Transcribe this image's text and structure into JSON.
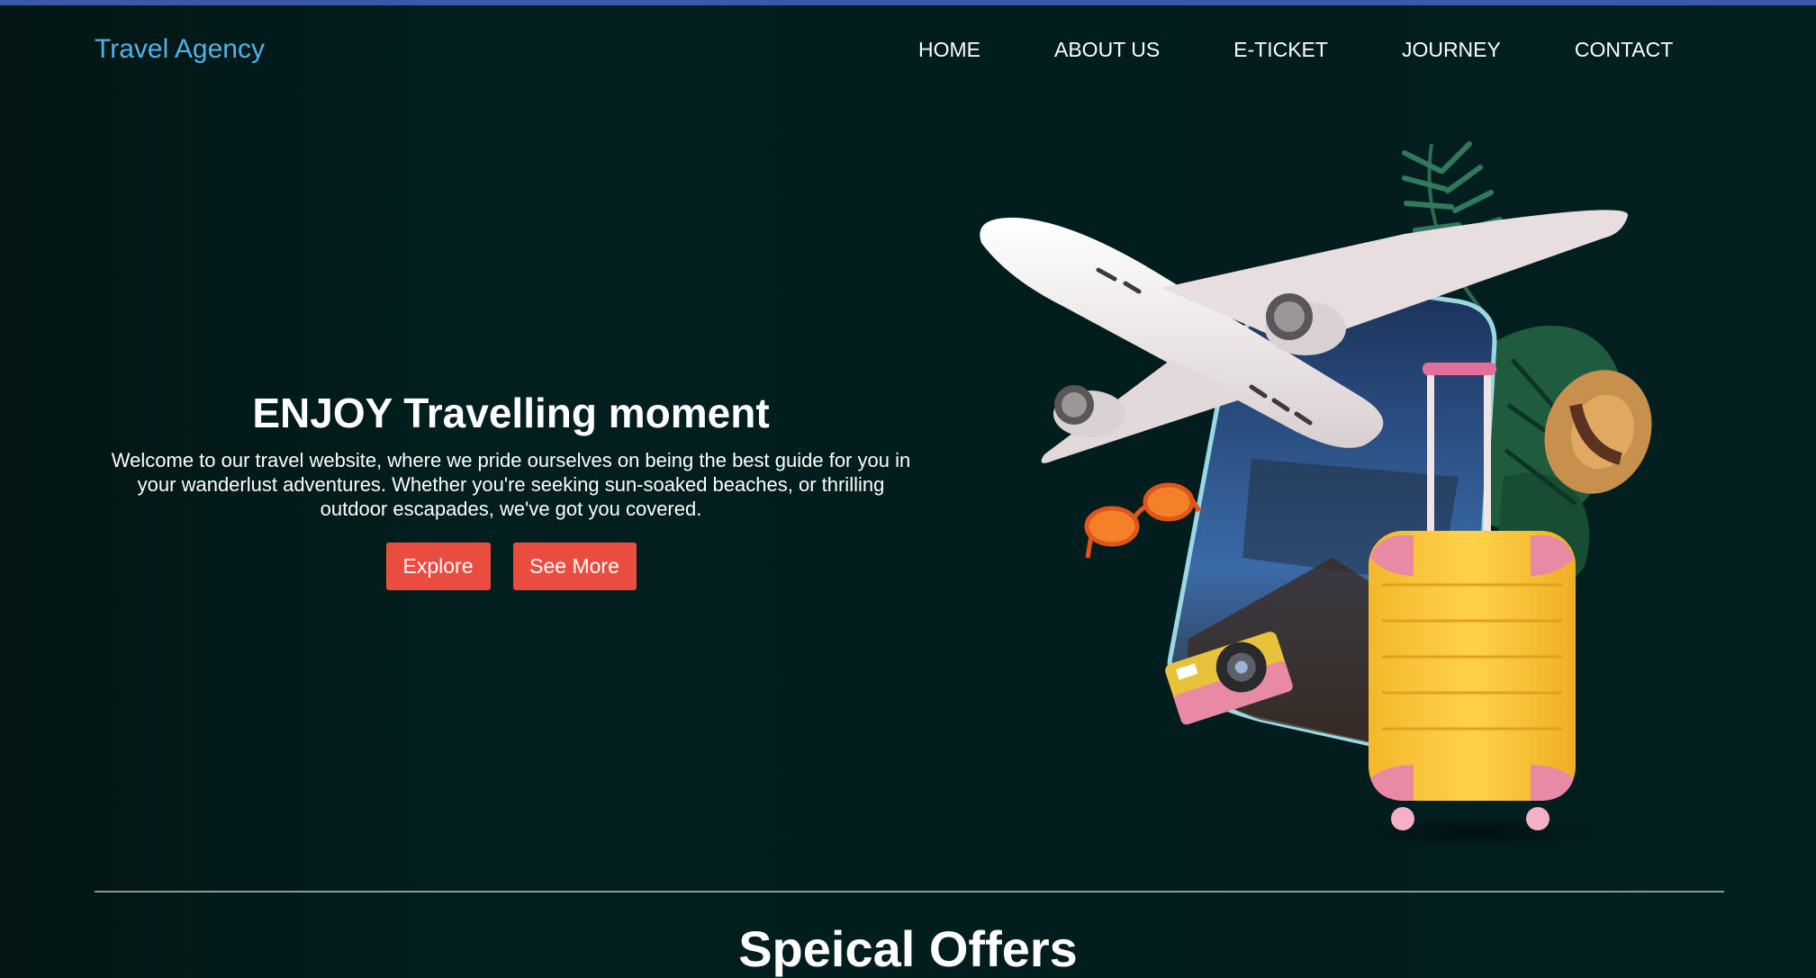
{
  "header": {
    "brand": "Travel Agency",
    "nav": [
      "HOME",
      "ABOUT US",
      "E-TICKET",
      "JOURNEY",
      "CONTACT"
    ]
  },
  "hero": {
    "title": "ENJOY Travelling moment",
    "description": "Welcome to our travel website, where we pride ourselves on being the best guide for you in your wanderlust adventures. Whether you're seeking sun-soaked beaches, or thrilling outdoor escapades, we've got you covered.",
    "buttons": {
      "explore": "Explore",
      "see_more": "See More"
    }
  },
  "offers": {
    "title": "Speical Offers"
  },
  "colors": {
    "accent_bar": "#3a57a8",
    "brand": "#4fb3ea",
    "button": "#ea4c3f",
    "background": "#021e1e"
  }
}
